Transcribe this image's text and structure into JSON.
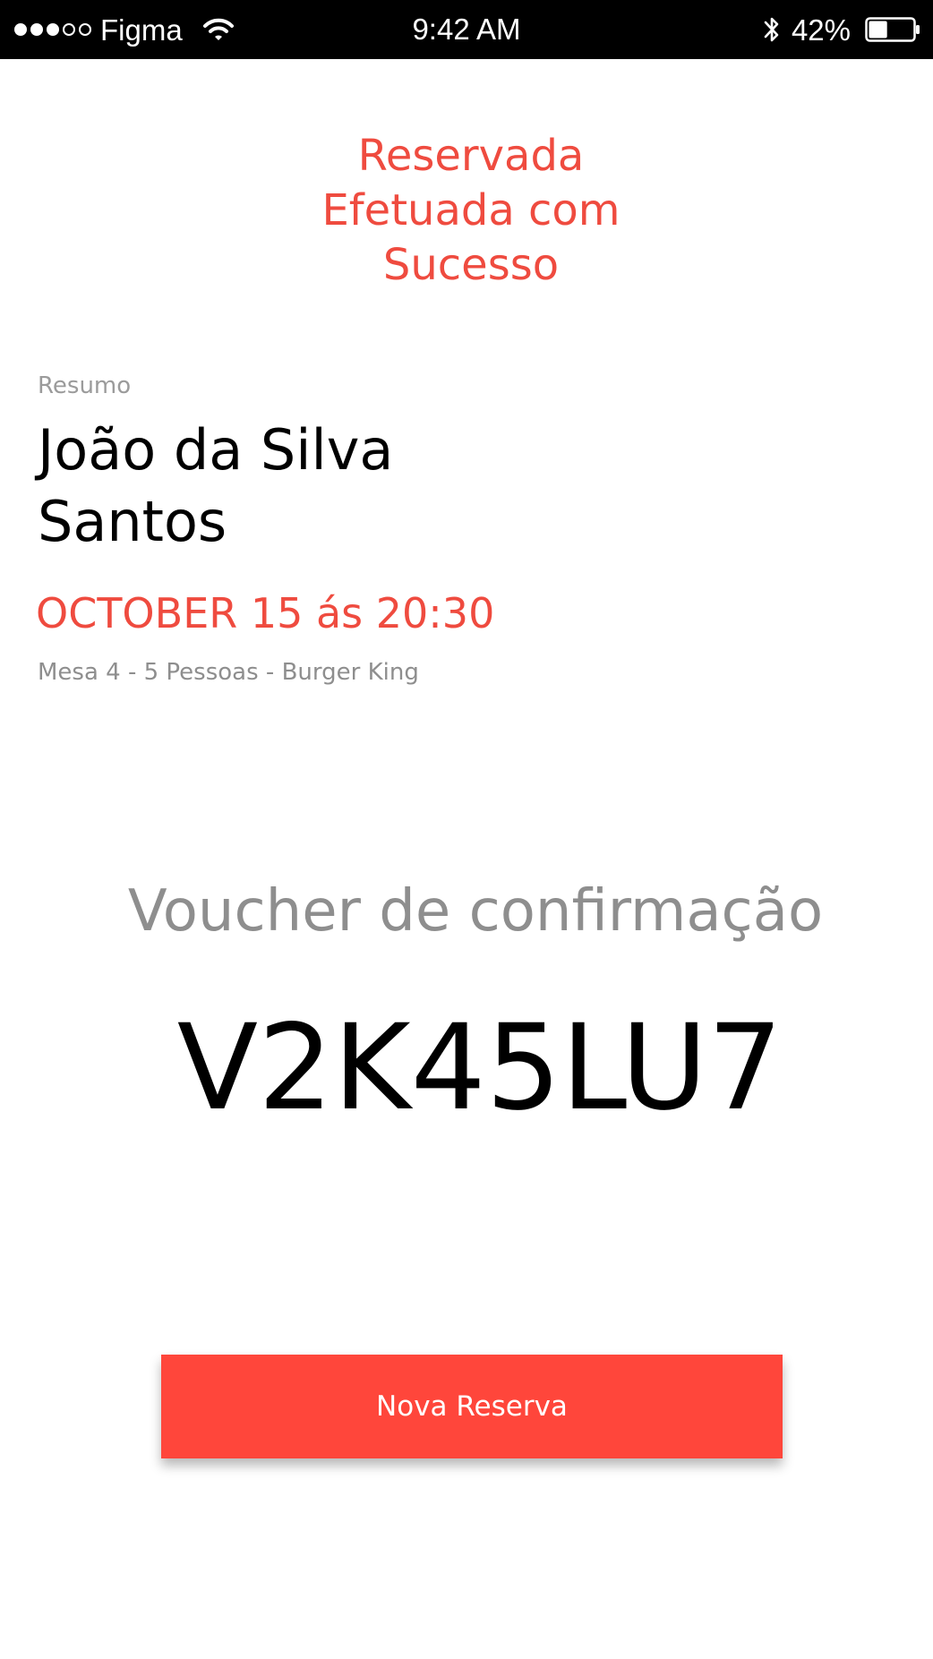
{
  "status_bar": {
    "signal_dots": [
      true,
      true,
      true,
      false,
      false
    ],
    "carrier": "Figma",
    "time": "9:42 AM",
    "battery_percent": "42%",
    "battery_level": 0.42,
    "icons": [
      "signal-dots-icon",
      "wifi-icon",
      "bluetooth-icon",
      "battery-icon"
    ]
  },
  "header": {
    "title_lines": [
      "Reservada",
      "Efetuada com",
      "Sucesso"
    ]
  },
  "summary": {
    "label": "Resumo",
    "name_lines": [
      "João da Silva",
      "Santos"
    ],
    "date_time": "OCTOBER 15 ás 20:30",
    "details": "Mesa 4 - 5 Pessoas - Burger King"
  },
  "voucher": {
    "label": "Voucher de confirmação",
    "code": "V2K45LU7"
  },
  "actions": {
    "new_reservation_label": "Nova Reserva"
  },
  "colors": {
    "accent": "#ef4b3f",
    "button": "#ff463b",
    "muted_text": "#8e8e8e",
    "status_bar": "#000000"
  }
}
